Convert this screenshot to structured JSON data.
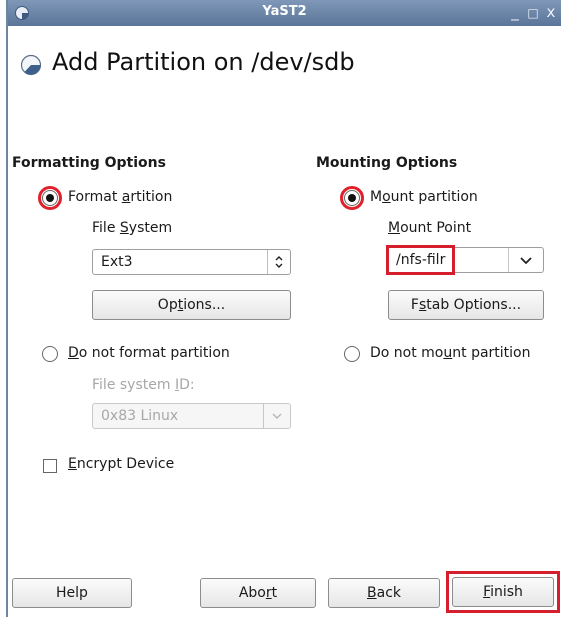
{
  "window": {
    "title": "YaST2",
    "minimize_glyph": "_",
    "maximize_glyph": "□",
    "close_glyph": "x"
  },
  "dialog": {
    "title": "Add Partition on /dev/sdb"
  },
  "formatting": {
    "heading": "Formatting Options",
    "format_partition": {
      "before": "Format ",
      "access_key": "a",
      "after": "rtition",
      "selected": true
    },
    "file_system_label": {
      "before": "File ",
      "access_key": "S",
      "after": "ystem"
    },
    "file_system_value": "Ext3",
    "options_button": {
      "before": "Op",
      "access_key": "t",
      "after": "ions..."
    },
    "do_not_format": {
      "before": "",
      "access_key": "D",
      "after": "o not format partition",
      "selected": false
    },
    "fs_id_label": {
      "before": "File system ",
      "access_key": "I",
      "after": "D:"
    },
    "fs_id_value": "0x83 Linux",
    "encrypt": {
      "before": "",
      "access_key": "E",
      "after": "ncrypt Device",
      "checked": false
    }
  },
  "mounting": {
    "heading": "Mounting Options",
    "mount_partition": {
      "before": "M",
      "access_key": "o",
      "after": "unt partition",
      "selected": true
    },
    "mount_point_label": {
      "before": "",
      "access_key": "M",
      "after": "ount Point"
    },
    "mount_point_value": "/nfs-filr",
    "fstab_button": {
      "before": "F",
      "access_key": "s",
      "after": "tab Options..."
    },
    "do_not_mount": {
      "before": "Do not mo",
      "access_key": "u",
      "after": "nt partition",
      "selected": false
    }
  },
  "buttons": {
    "help": "Help",
    "abort": {
      "before": "Abo",
      "access_key": "r",
      "after": "t"
    },
    "back": {
      "before": "",
      "access_key": "B",
      "after": "ack"
    },
    "finish": {
      "before": "",
      "access_key": "F",
      "after": "inish"
    }
  },
  "colors": {
    "highlight": "#e0202a",
    "titlebar": "#6b84a6"
  }
}
